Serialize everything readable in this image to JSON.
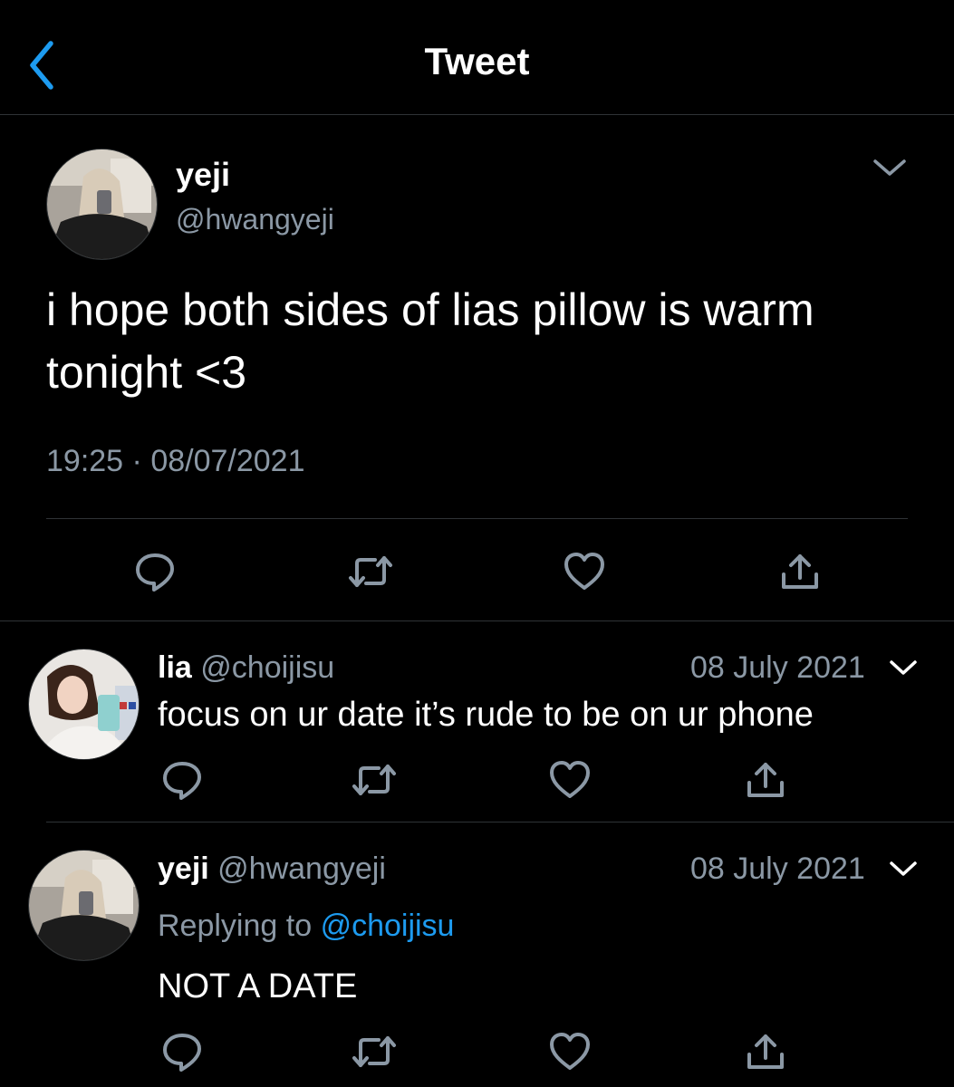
{
  "header": {
    "title": "Tweet"
  },
  "main_tweet": {
    "name": "yeji",
    "handle": "@hwangyeji",
    "text_line1": "i hope both sides of lias pillow is warm",
    "text_line2": "tonight <3",
    "time": "19:25",
    "separator": "·",
    "date": "08/07/2021"
  },
  "replies": [
    {
      "name": "lia",
      "handle": "@choijisu",
      "date": "08 July 2021",
      "text": "focus on ur date it’s rude to be on ur phone"
    },
    {
      "name": "yeji",
      "handle": "@hwangyeji",
      "date": "08 July 2021",
      "replying_prefix": "Replying to",
      "replying_handle": "@choijisu",
      "text": "NOT A DATE"
    }
  ],
  "icons": {
    "back": "chevron-left-icon",
    "menu": "chevron-down-icon",
    "reply": "reply-icon",
    "retweet": "retweet-icon",
    "like": "heart-icon",
    "share": "share-icon"
  },
  "colors": {
    "background": "#000000",
    "text": "#ffffff",
    "secondary": "#8b98a5",
    "divider": "#2f3336",
    "accent": "#1d9bf0"
  }
}
